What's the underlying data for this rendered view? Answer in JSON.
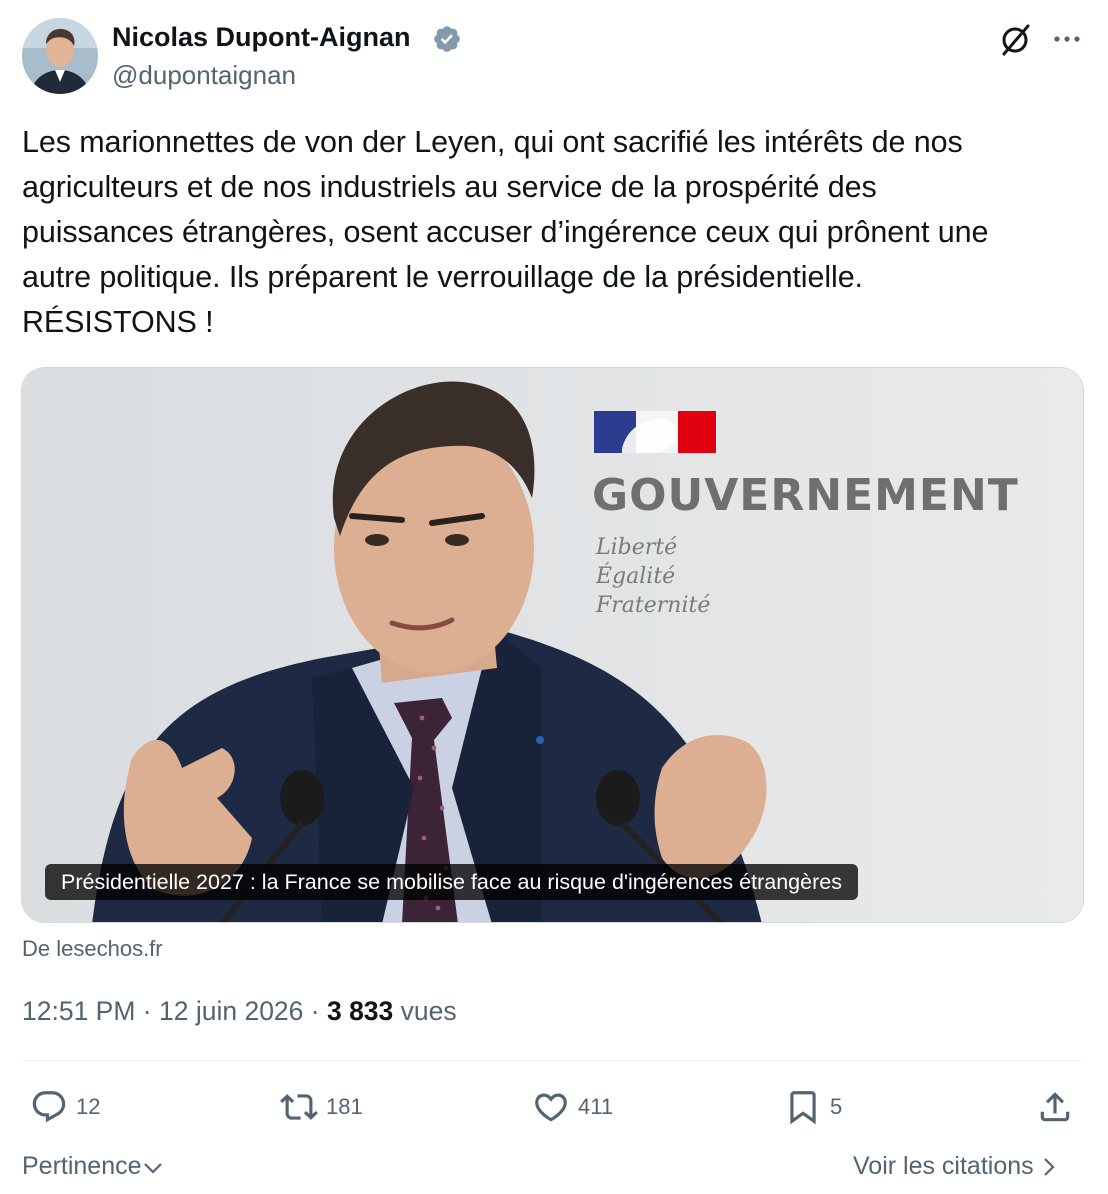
{
  "author": {
    "name": "Nicolas Dupont-Aignan",
    "handle": "@dupontaignan",
    "verified_color": "#829aab"
  },
  "tweet": {
    "lines": [
      "Les marionnettes de von der Leyen, qui ont sacrifié les intérêts de nos",
      "agriculteurs et de nos industriels au service de la prospérité des",
      "puissances étrangères, osent accuser d’ingérence ceux qui prônent une",
      "autre politique.  Ils préparent le verrouillage de la présidentielle.",
      "RÉSISTONS !"
    ]
  },
  "card": {
    "caption": "Présidentielle 2027 : la France se mobilise face au risque d'ingérences étrangères",
    "source": "De lesechos.fr",
    "photo_sign": {
      "title": "GOUVERNEMENT",
      "motto": [
        "Liberté",
        "Égalité",
        "Fraternité"
      ]
    }
  },
  "meta": {
    "time": "12:51 PM",
    "date": "12 juin 2026",
    "views_count": "3 833",
    "views_label": "vues",
    "separator": " · "
  },
  "actions": {
    "replies": "12",
    "reposts": "181",
    "likes": "411",
    "bookmarks": "5"
  },
  "footer": {
    "sort_label": "Pertinence",
    "quotes_label": "Voir les citations"
  },
  "icons": {
    "top_right": [
      "grok-icon",
      "more-icon"
    ],
    "actions": [
      "reply-icon",
      "repost-icon",
      "like-icon",
      "bookmark-icon",
      "share-icon"
    ]
  },
  "colors": {
    "text": "#0f1419",
    "secondary": "#536471",
    "divider": "#eff3f4"
  }
}
